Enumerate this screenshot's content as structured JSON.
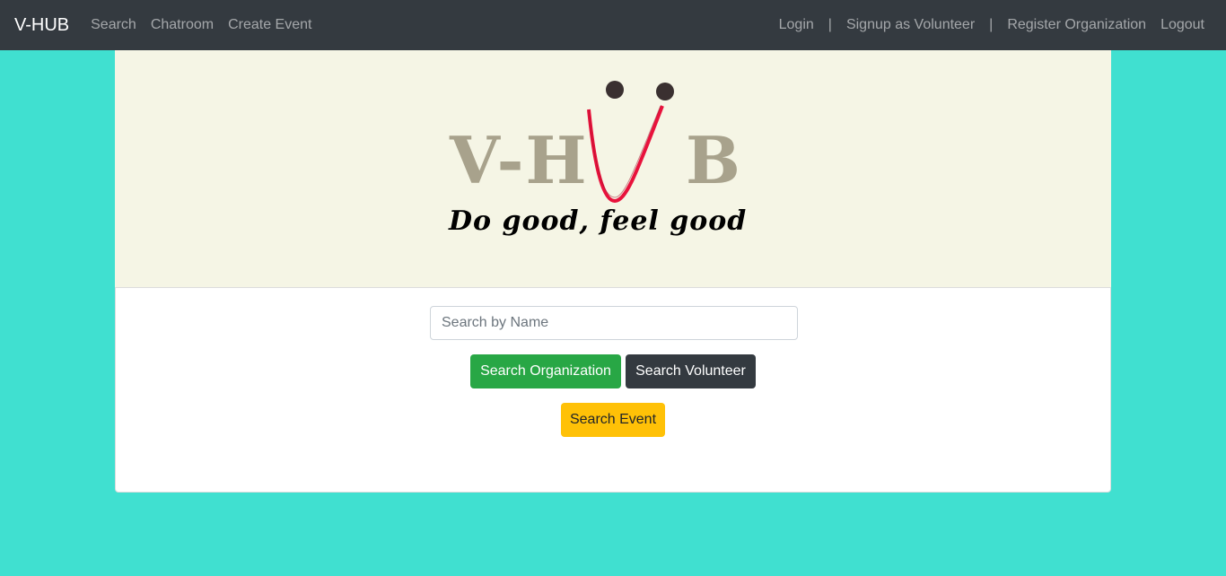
{
  "nav": {
    "brand": "V-HUB",
    "left_links": [
      "Search",
      "Chatroom",
      "Create Event"
    ],
    "right_links": {
      "login": "Login",
      "signup": "Signup as Volunteer",
      "register": "Register Organization",
      "logout": "Logout",
      "separator": "|"
    }
  },
  "logo": {
    "text_left": "V-H",
    "text_right": "B",
    "tagline": "Do good, feel good"
  },
  "search": {
    "placeholder": "Search by Name",
    "value": ""
  },
  "buttons": {
    "organization": "Search Organization",
    "volunteer": "Search Volunteer",
    "event": "Search Event"
  },
  "colors": {
    "background": "#40e0d0",
    "navbar": "#343a40",
    "banner": "#f5f5e5",
    "smile": "#e8123c"
  }
}
